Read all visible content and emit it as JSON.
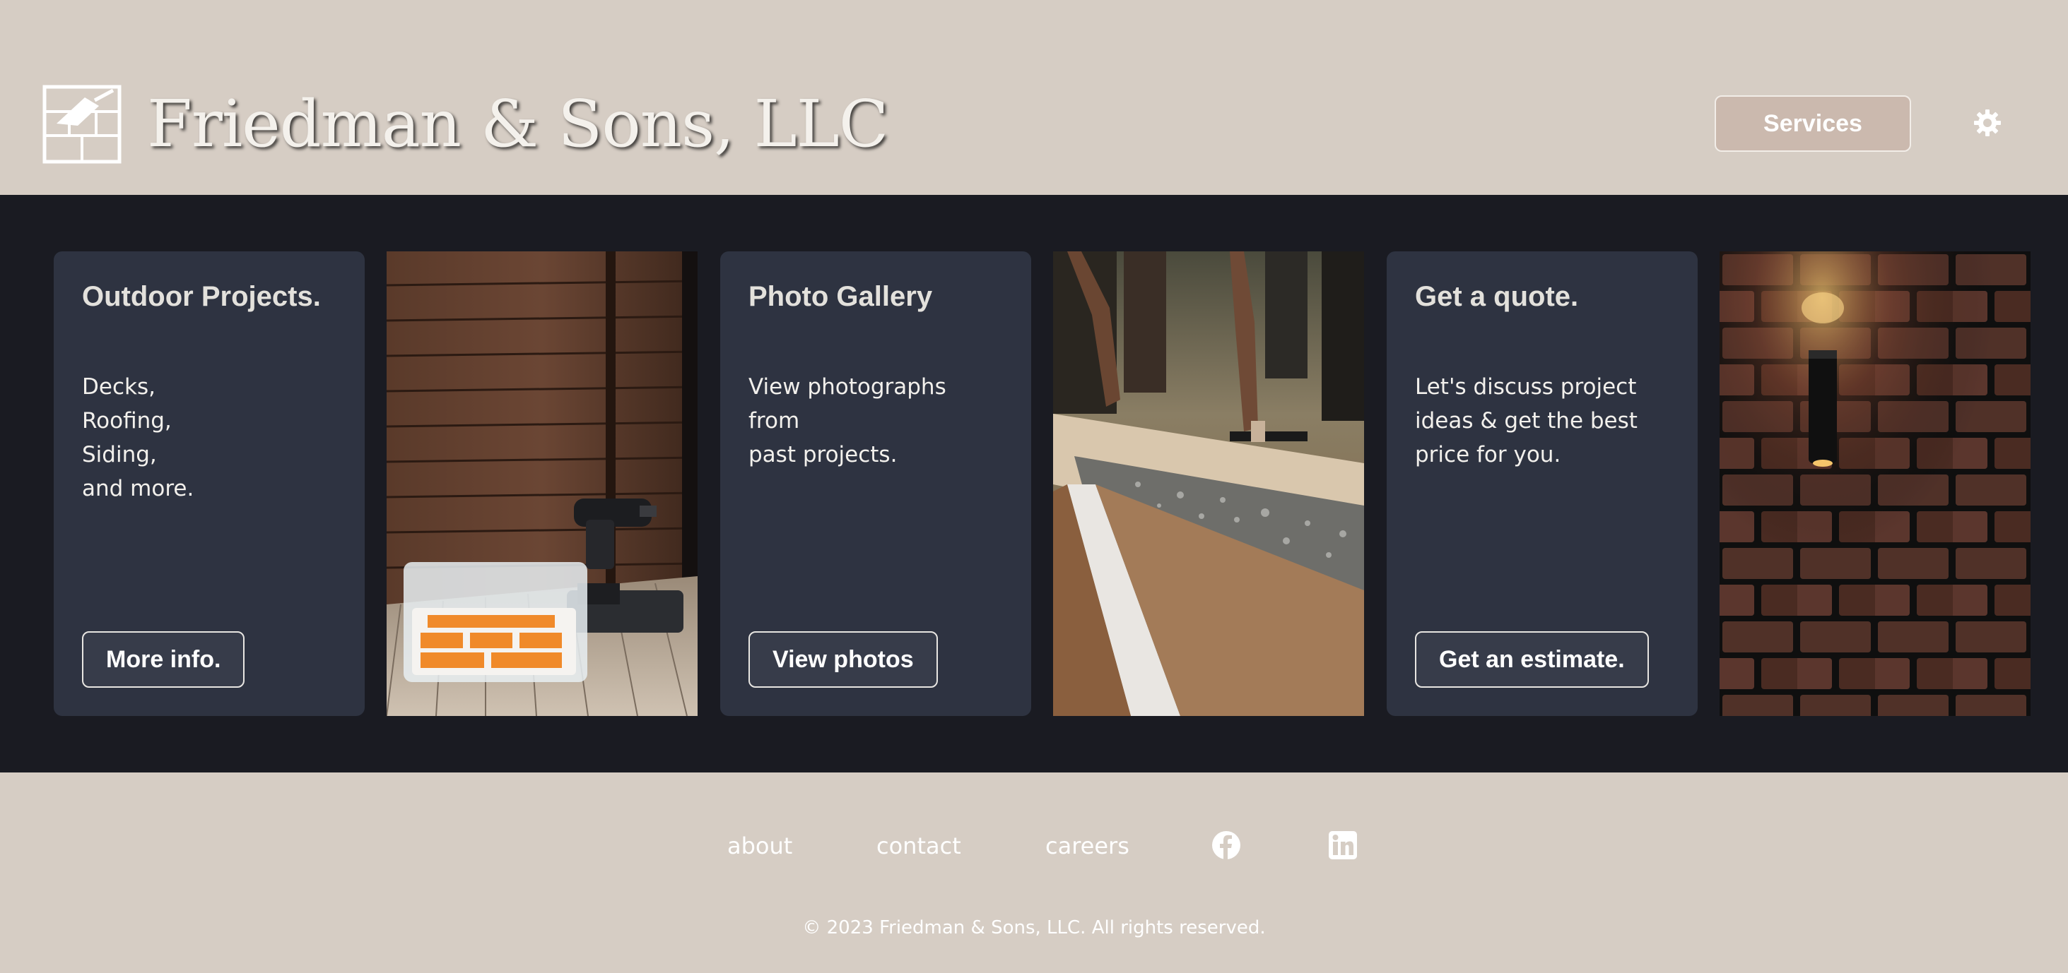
{
  "header": {
    "brand": "Friedman & Sons, LLC",
    "logo_icon": "trowel-brick-logo",
    "services_label": "Services",
    "settings_icon": "gear-icon"
  },
  "cards": [
    {
      "title": "Outdoor Projects.",
      "body": "Decks,\nRoofing,\nSiding,\nand more.",
      "button": "More info."
    },
    {
      "title": "Photo Gallery",
      "body": "View photographs from\npast projects.",
      "button": "View photos"
    },
    {
      "title": "Get a quote.",
      "body": "Let's discuss project\nideas & get the best\nprice for you.",
      "button": "Get an estimate."
    }
  ],
  "photos": [
    "wood-siding-drill-toolbox-photo",
    "concrete-pouring-photo",
    "brick-wall-lamp-photo"
  ],
  "footer": {
    "links": [
      "about",
      "contact",
      "careers"
    ],
    "icons": [
      "facebook-icon",
      "linkedin-icon"
    ],
    "copyright": "© 2023 Friedman & Sons, LLC. All rights reserved."
  },
  "colors": {
    "header_bg": "#d6cdc4",
    "main_bg": "#1a1b22",
    "card_bg": "#2e3341",
    "services_bg": "#cbb9ae"
  }
}
